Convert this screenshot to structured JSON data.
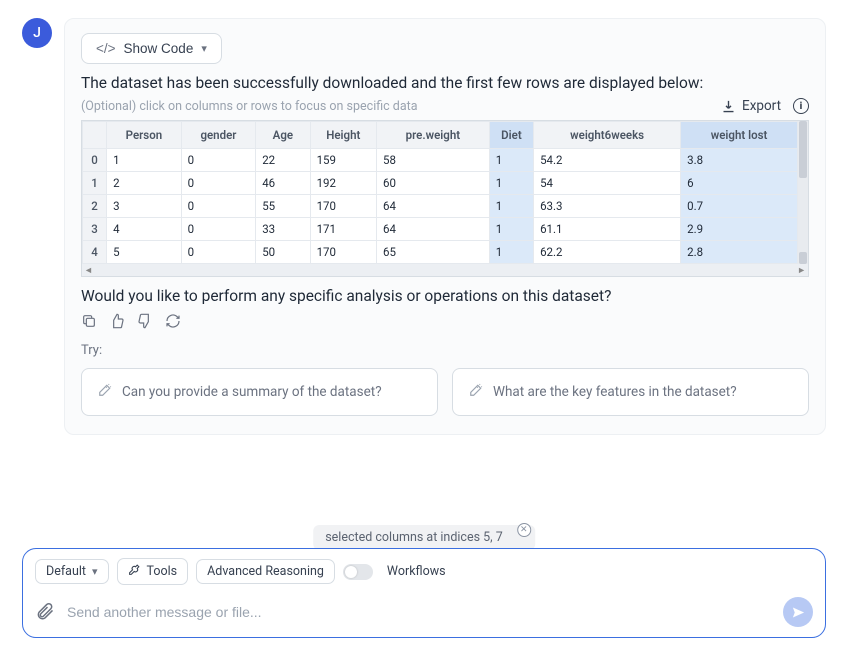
{
  "avatar_initial": "J",
  "show_code_label": "Show Code",
  "msg1": "The dataset has been successfully downloaded and the first few rows are displayed below:",
  "table_hint": "(Optional) click on columns or rows to focus on specific data",
  "export_label": "Export",
  "columns": [
    "Person",
    "gender",
    "Age",
    "Height",
    "pre.weight",
    "Diet",
    "weight6weeks",
    "weight lost"
  ],
  "selected_col_indices": [
    5,
    7
  ],
  "rows": [
    {
      "idx": "0",
      "cells": [
        "1",
        "0",
        "22",
        "159",
        "58",
        "1",
        "54.2",
        "3.8"
      ]
    },
    {
      "idx": "1",
      "cells": [
        "2",
        "0",
        "46",
        "192",
        "60",
        "1",
        "54",
        "6"
      ]
    },
    {
      "idx": "2",
      "cells": [
        "3",
        "0",
        "55",
        "170",
        "64",
        "1",
        "63.3",
        "0.7"
      ]
    },
    {
      "idx": "3",
      "cells": [
        "4",
        "0",
        "33",
        "171",
        "64",
        "1",
        "61.1",
        "2.9"
      ]
    },
    {
      "idx": "4",
      "cells": [
        "5",
        "0",
        "50",
        "170",
        "65",
        "1",
        "62.2",
        "2.8"
      ]
    }
  ],
  "followup": "Would you like to perform any specific analysis or operations on this dataset?",
  "try_label": "Try:",
  "suggestions": [
    "Can you provide a summary of the dataset?",
    "What are the key features in the dataset?"
  ],
  "chip_text": "selected columns at indices 5, 7",
  "composer": {
    "default_label": "Default",
    "tools_label": "Tools",
    "reasoning_label": "Advanced Reasoning",
    "workflows_label": "Workflows",
    "placeholder": "Send another message or file..."
  }
}
